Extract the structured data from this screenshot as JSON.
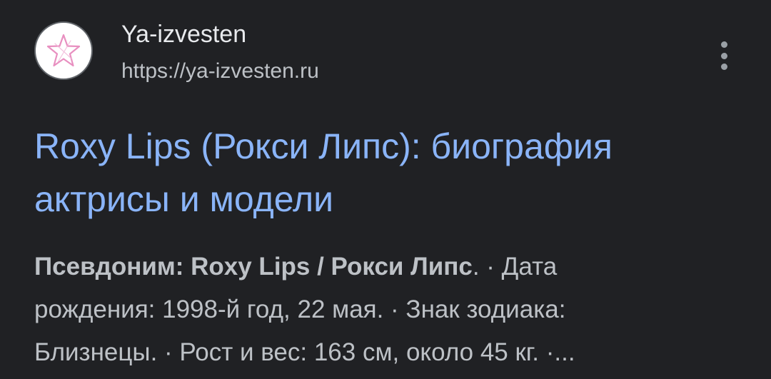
{
  "result": {
    "site_name": "Ya-izvesten",
    "site_url": "https://ya-izvesten.ru",
    "favicon": {
      "icon": "star-outline-icon",
      "color": "#e88fc0",
      "background": "#ffffff"
    },
    "menu_icon": "more-vert-icon",
    "title": "Roxy Lips (Рокси Липс): биография актрисы и модели",
    "snippet": {
      "line1_bold": "Псевдоним: Roxy Lips / Рокси Липс",
      "line1_rest": ". · Дата",
      "line2": "рождения: 1998-й год, 22 мая. · Знак зодиака:",
      "line3": "Близнецы. · Рост и вес: 163 см, около 45 кг. ·..."
    }
  },
  "colors": {
    "background": "#202124",
    "title_link": "#8ab4f8",
    "primary_text": "#e8eaed",
    "secondary_text": "#bdc1c6"
  }
}
